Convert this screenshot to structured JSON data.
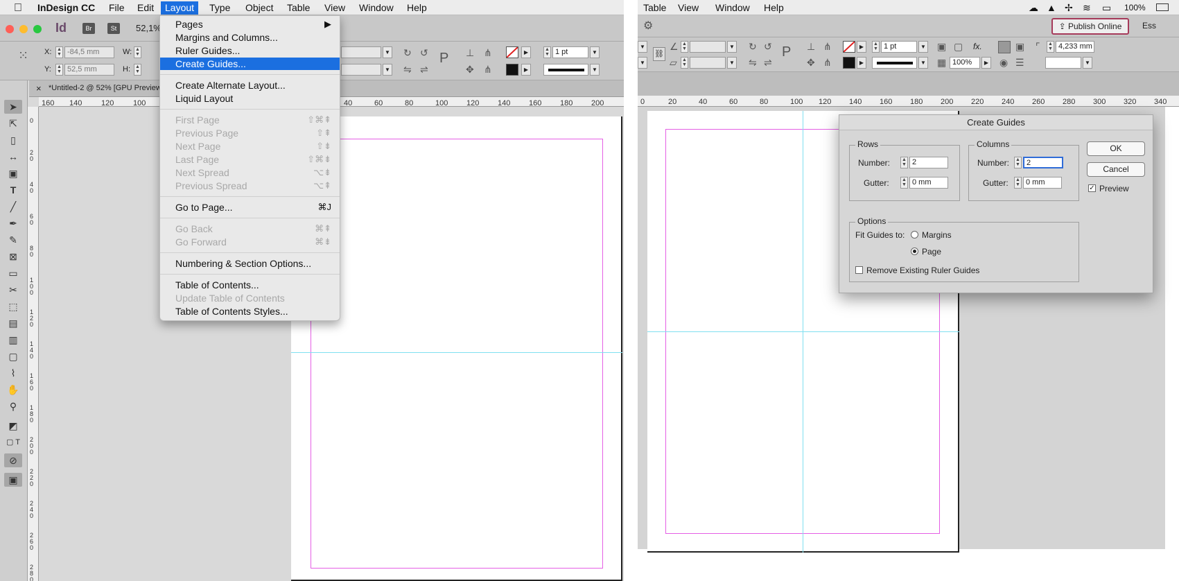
{
  "left": {
    "menubar": {
      "apple": "",
      "app": "InDesign CC",
      "items": [
        "File",
        "Edit",
        "Layout",
        "Type",
        "Object",
        "Table",
        "View",
        "Window",
        "Help"
      ]
    },
    "appbar": {
      "id_logo": "Id",
      "bridge": "Br",
      "stock": "St",
      "zoom": "52,1%"
    },
    "control": {
      "x_label": "X:",
      "x_value": "-84,5 mm",
      "y_label": "Y:",
      "y_value": "52,5 mm",
      "w_label": "W:",
      "h_label": "H:",
      "stroke_weight": "1 pt"
    },
    "doc_tab": {
      "close": "×",
      "title": "*Untitled-2 @ 52% [GPU Preview]"
    },
    "hruler": [
      "160",
      "140",
      "120",
      "100",
      "40",
      "60",
      "80",
      "100",
      "120",
      "140",
      "160",
      "180",
      "200"
    ],
    "vruler": [
      "0",
      "20",
      "40",
      "60",
      "80",
      "100",
      "120",
      "140",
      "160",
      "180",
      "200",
      "220",
      "240",
      "260",
      "280"
    ],
    "menu": {
      "items": [
        {
          "label": "Pages",
          "shortcut": "▶",
          "state": "normal"
        },
        {
          "label": "Margins and Columns...",
          "shortcut": "",
          "state": "normal"
        },
        {
          "label": "Ruler Guides...",
          "shortcut": "",
          "state": "normal"
        },
        {
          "label": "Create Guides...",
          "shortcut": "",
          "state": "highlight"
        },
        {
          "label": "Create Alternate Layout...",
          "shortcut": "",
          "state": "normal"
        },
        {
          "label": "Liquid Layout",
          "shortcut": "",
          "state": "normal"
        },
        {
          "label": "First Page",
          "shortcut": "⇧⌘⇞",
          "state": "disabled"
        },
        {
          "label": "Previous Page",
          "shortcut": "⇧⇞",
          "state": "disabled"
        },
        {
          "label": "Next Page",
          "shortcut": "⇧⇟",
          "state": "disabled"
        },
        {
          "label": "Last Page",
          "shortcut": "⇧⌘⇟",
          "state": "disabled"
        },
        {
          "label": "Next Spread",
          "shortcut": "⌥⇟",
          "state": "disabled"
        },
        {
          "label": "Previous Spread",
          "shortcut": "⌥⇞",
          "state": "disabled"
        },
        {
          "label": "Go to Page...",
          "shortcut": "⌘J",
          "state": "normal"
        },
        {
          "label": "Go Back",
          "shortcut": "⌘⇞",
          "state": "disabled"
        },
        {
          "label": "Go Forward",
          "shortcut": "⌘⇟",
          "state": "disabled"
        },
        {
          "label": "Numbering & Section Options...",
          "shortcut": "",
          "state": "normal"
        },
        {
          "label": "Table of Contents...",
          "shortcut": "",
          "state": "normal"
        },
        {
          "label": "Update Table of Contents",
          "shortcut": "",
          "state": "disabled"
        },
        {
          "label": "Table of Contents Styles...",
          "shortcut": "",
          "state": "normal"
        }
      ]
    }
  },
  "right": {
    "menubar": {
      "items": [
        "Table",
        "View",
        "Window",
        "Help"
      ],
      "battery": "100%"
    },
    "appbar": {
      "publish": "Publish Online",
      "essentials": "Ess"
    },
    "control": {
      "stroke_weight": "1 pt",
      "opacity": "100%",
      "size_value": "4,233 mm",
      "fx": "fx."
    },
    "hruler": [
      "0",
      "20",
      "40",
      "60",
      "80",
      "100",
      "120",
      "140",
      "160",
      "180",
      "200",
      "220",
      "240",
      "260",
      "280",
      "300",
      "320",
      "340"
    ],
    "dialog": {
      "title": "Create Guides",
      "rows": {
        "title": "Rows",
        "number_label": "Number:",
        "number_value": "2",
        "gutter_label": "Gutter:",
        "gutter_value": "0 mm"
      },
      "columns": {
        "title": "Columns",
        "number_label": "Number:",
        "number_value": "2",
        "gutter_label": "Gutter:",
        "gutter_value": "0 mm"
      },
      "options": {
        "title": "Options",
        "fit_label": "Fit Guides to:",
        "margins_label": "Margins",
        "page_label": "Page",
        "selected": "Page",
        "remove_label": "Remove Existing Ruler Guides",
        "remove_checked": false
      },
      "ok": "OK",
      "cancel": "Cancel",
      "preview_label": "Preview",
      "preview_checked": true
    }
  },
  "colors": {
    "highlight": "#1b6fe0",
    "margin_guide": "#e55ee5",
    "ruler_guide": "#7fe0f0",
    "close": "#ff5f57",
    "minimize": "#febc2e",
    "zoom": "#28c840"
  }
}
